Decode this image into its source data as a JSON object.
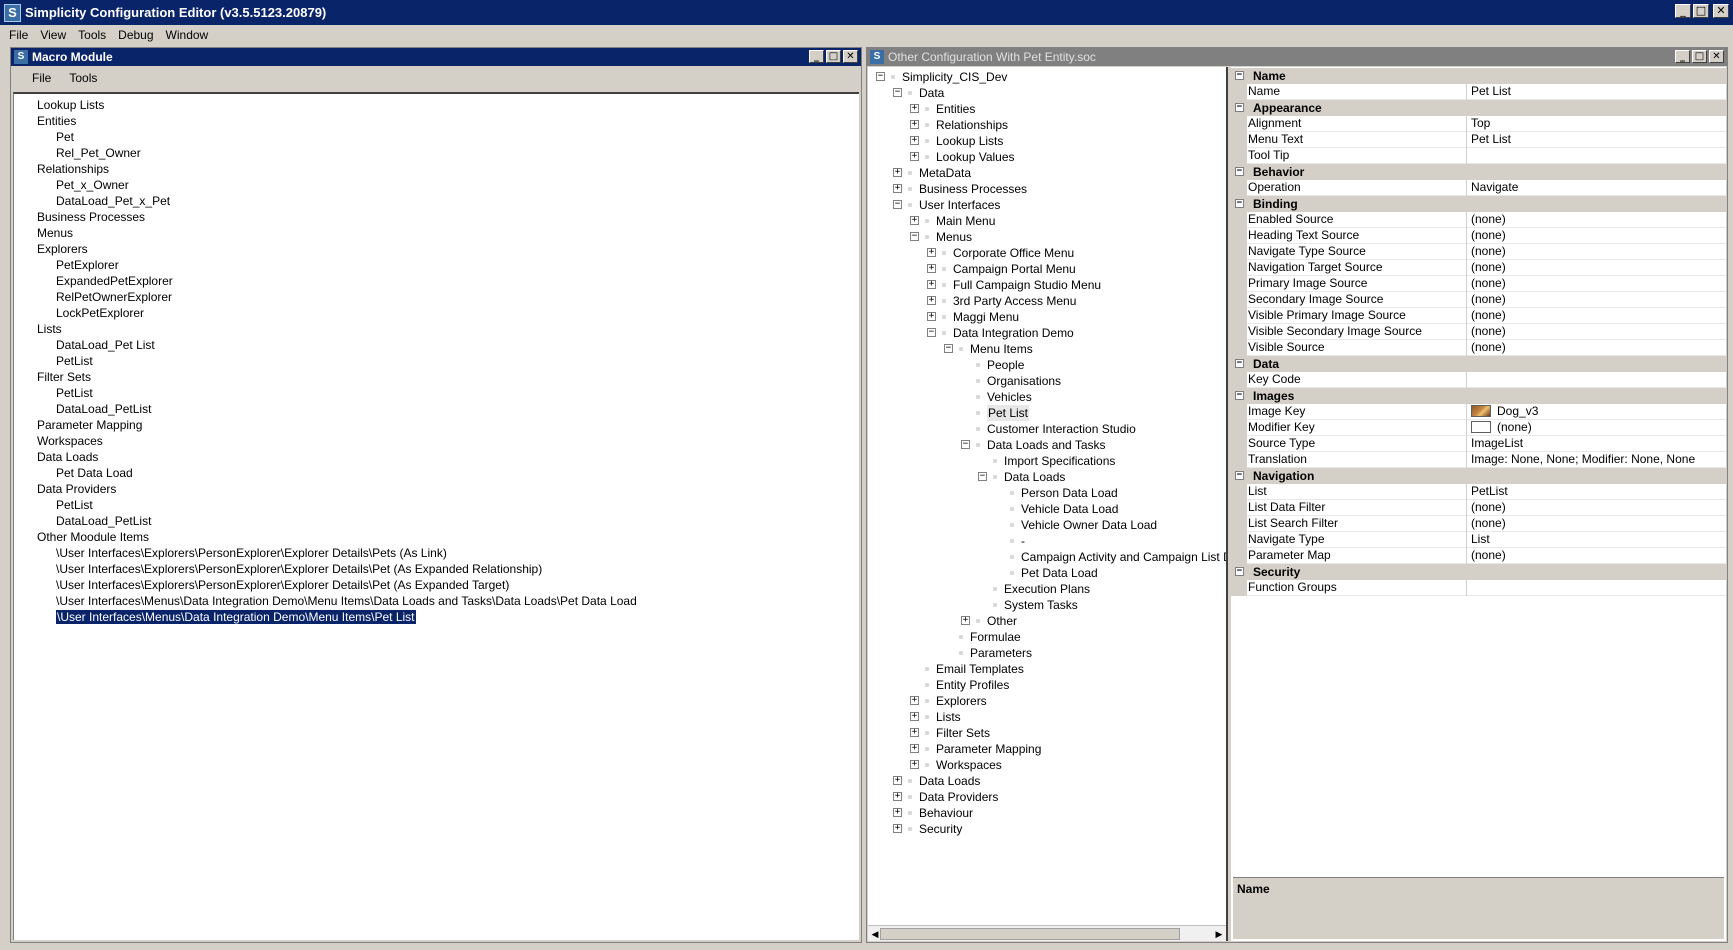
{
  "app": {
    "title": "Simplicity Configuration Editor (v3.5.5123.20879)",
    "logo_letter": "S",
    "menu": [
      "File",
      "View",
      "Tools",
      "Debug",
      "Window"
    ]
  },
  "macro_module": {
    "title": "Macro Module",
    "menu": [
      "File",
      "Tools"
    ],
    "items": [
      {
        "text": "Lookup Lists",
        "level": 0
      },
      {
        "text": "Entities",
        "level": 0
      },
      {
        "text": "Pet",
        "level": 1
      },
      {
        "text": "Rel_Pet_Owner",
        "level": 1
      },
      {
        "text": "Relationships",
        "level": 0
      },
      {
        "text": "Pet_x_Owner",
        "level": 1
      },
      {
        "text": "DataLoad_Pet_x_Pet",
        "level": 1
      },
      {
        "text": "Business Processes",
        "level": 0
      },
      {
        "text": "Menus",
        "level": 0
      },
      {
        "text": "Explorers",
        "level": 0
      },
      {
        "text": "PetExplorer",
        "level": 1
      },
      {
        "text": "ExpandedPetExplorer",
        "level": 1
      },
      {
        "text": "RelPetOwnerExplorer",
        "level": 1
      },
      {
        "text": "LockPetExplorer",
        "level": 1
      },
      {
        "text": "Lists",
        "level": 0
      },
      {
        "text": "DataLoad_Pet List",
        "level": 1
      },
      {
        "text": "PetList",
        "level": 1
      },
      {
        "text": "Filter Sets",
        "level": 0
      },
      {
        "text": "PetList",
        "level": 1
      },
      {
        "text": "DataLoad_PetList",
        "level": 1
      },
      {
        "text": "Parameter Mapping",
        "level": 0
      },
      {
        "text": "Workspaces",
        "level": 0
      },
      {
        "text": "Data Loads",
        "level": 0
      },
      {
        "text": "Pet Data Load",
        "level": 1
      },
      {
        "text": "Data Providers",
        "level": 0
      },
      {
        "text": "PetList",
        "level": 1
      },
      {
        "text": "DataLoad_PetList",
        "level": 1
      },
      {
        "text": "Other Moodule Items",
        "level": 0
      },
      {
        "text": "\\User Interfaces\\Explorers\\PersonExplorer\\Explorer Details\\Pets (As Link)",
        "level": 1
      },
      {
        "text": "\\User Interfaces\\Explorers\\PersonExplorer\\Explorer Details\\Pet (As Expanded Relationship)",
        "level": 1
      },
      {
        "text": "\\User Interfaces\\Explorers\\PersonExplorer\\Explorer Details\\Pet (As Expanded Target)",
        "level": 1
      },
      {
        "text": "\\User Interfaces\\Menus\\Data Integration Demo\\Menu Items\\Data Loads and Tasks\\Data Loads\\Pet Data Load",
        "level": 1
      },
      {
        "text": "\\User Interfaces\\Menus\\Data Integration Demo\\Menu Items\\Pet List",
        "level": 1,
        "selected": true
      }
    ]
  },
  "config": {
    "title": "Other Configuration With Pet Entity.soc",
    "tree": [
      {
        "text": "Simplicity_CIS_Dev",
        "level": 0,
        "exp": "-"
      },
      {
        "text": "Data",
        "level": 1,
        "exp": "-"
      },
      {
        "text": "Entities",
        "level": 2,
        "exp": "+"
      },
      {
        "text": "Relationships",
        "level": 2,
        "exp": "+"
      },
      {
        "text": "Lookup Lists",
        "level": 2,
        "exp": "+"
      },
      {
        "text": "Lookup Values",
        "level": 2,
        "exp": "+"
      },
      {
        "text": "MetaData",
        "level": 1,
        "exp": "+"
      },
      {
        "text": "Business Processes",
        "level": 1,
        "exp": "+"
      },
      {
        "text": "User Interfaces",
        "level": 1,
        "exp": "-"
      },
      {
        "text": "Main Menu",
        "level": 2,
        "exp": "+"
      },
      {
        "text": "Menus",
        "level": 2,
        "exp": "-"
      },
      {
        "text": "Corporate Office Menu",
        "level": 3,
        "exp": "+"
      },
      {
        "text": "Campaign Portal Menu",
        "level": 3,
        "exp": "+"
      },
      {
        "text": "Full Campaign Studio Menu",
        "level": 3,
        "exp": "+"
      },
      {
        "text": "3rd Party Access Menu",
        "level": 3,
        "exp": "+"
      },
      {
        "text": "Maggi Menu",
        "level": 3,
        "exp": "+"
      },
      {
        "text": "Data Integration Demo",
        "level": 3,
        "exp": "-"
      },
      {
        "text": "Menu Items",
        "level": 4,
        "exp": "-"
      },
      {
        "text": "People",
        "level": 5,
        "exp": ""
      },
      {
        "text": "Organisations",
        "level": 5,
        "exp": ""
      },
      {
        "text": "Vehicles",
        "level": 5,
        "exp": ""
      },
      {
        "text": "Pet List",
        "level": 5,
        "exp": "",
        "highlight": true
      },
      {
        "text": "Customer Interaction Studio",
        "level": 5,
        "exp": ""
      },
      {
        "text": "Data Loads and Tasks",
        "level": 5,
        "exp": "-"
      },
      {
        "text": "Import Specifications",
        "level": 6,
        "exp": ""
      },
      {
        "text": "Data Loads",
        "level": 6,
        "exp": "-"
      },
      {
        "text": "Person Data Load",
        "level": 7,
        "exp": ""
      },
      {
        "text": "Vehicle Data Load",
        "level": 7,
        "exp": ""
      },
      {
        "text": "Vehicle Owner Data Load",
        "level": 7,
        "exp": ""
      },
      {
        "text": "-",
        "level": 7,
        "exp": ""
      },
      {
        "text": "Campaign Activity and Campaign List D",
        "level": 7,
        "exp": ""
      },
      {
        "text": "Pet Data Load",
        "level": 7,
        "exp": ""
      },
      {
        "text": "Execution Plans",
        "level": 6,
        "exp": ""
      },
      {
        "text": "System Tasks",
        "level": 6,
        "exp": ""
      },
      {
        "text": "Other",
        "level": 5,
        "exp": "+"
      },
      {
        "text": "Formulae",
        "level": 4,
        "exp": ""
      },
      {
        "text": "Parameters",
        "level": 4,
        "exp": ""
      },
      {
        "text": "Email Templates",
        "level": 2,
        "exp": ""
      },
      {
        "text": "Entity Profiles",
        "level": 2,
        "exp": ""
      },
      {
        "text": "Explorers",
        "level": 2,
        "exp": "+"
      },
      {
        "text": "Lists",
        "level": 2,
        "exp": "+"
      },
      {
        "text": "Filter Sets",
        "level": 2,
        "exp": "+"
      },
      {
        "text": "Parameter Mapping",
        "level": 2,
        "exp": "+"
      },
      {
        "text": "Workspaces",
        "level": 2,
        "exp": "+"
      },
      {
        "text": "Data Loads",
        "level": 1,
        "exp": "+"
      },
      {
        "text": "Data Providers",
        "level": 1,
        "exp": "+"
      },
      {
        "text": "Behaviour",
        "level": 1,
        "exp": "+"
      },
      {
        "text": "Security",
        "level": 1,
        "exp": "+"
      }
    ],
    "properties": [
      {
        "category": "Name",
        "rows": [
          {
            "key": "Name",
            "value": "Pet List"
          }
        ]
      },
      {
        "category": "Appearance",
        "rows": [
          {
            "key": "Alignment",
            "value": "Top"
          },
          {
            "key": "Menu Text",
            "value": "Pet List"
          },
          {
            "key": "Tool Tip",
            "value": ""
          }
        ]
      },
      {
        "category": "Behavior",
        "rows": [
          {
            "key": "Operation",
            "value": "Navigate"
          }
        ]
      },
      {
        "category": "Binding",
        "rows": [
          {
            "key": "Enabled Source",
            "value": "(none)"
          },
          {
            "key": "Heading Text Source",
            "value": "(none)"
          },
          {
            "key": "Navigate Type Source",
            "value": "(none)"
          },
          {
            "key": "Navigation Target Source",
            "value": "(none)"
          },
          {
            "key": "Primary Image Source",
            "value": "(none)"
          },
          {
            "key": "Secondary Image Source",
            "value": "(none)"
          },
          {
            "key": "Visible Primary Image Source",
            "value": "(none)"
          },
          {
            "key": "Visible Secondary Image Source",
            "value": "(none)"
          },
          {
            "key": "Visible Source",
            "value": "(none)"
          }
        ]
      },
      {
        "category": "Data",
        "rows": [
          {
            "key": "Key Code",
            "value": ""
          }
        ]
      },
      {
        "category": "Images",
        "rows": [
          {
            "key": "Image Key",
            "value": "Dog_v3",
            "swatch": "dog"
          },
          {
            "key": "Modifier Key",
            "value": "(none)",
            "swatch": "blank"
          },
          {
            "key": "Source Type",
            "value": "ImageList"
          },
          {
            "key": "Translation",
            "value": "Image: None, None; Modifier: None, None",
            "expand": "+"
          }
        ]
      },
      {
        "category": "Navigation",
        "rows": [
          {
            "key": "List",
            "value": "PetList"
          },
          {
            "key": "List Data Filter",
            "value": "(none)"
          },
          {
            "key": "List Search Filter",
            "value": "(none)"
          },
          {
            "key": "Navigate Type",
            "value": "List"
          },
          {
            "key": "Parameter Map",
            "value": "(none)"
          }
        ]
      },
      {
        "category": "Security",
        "rows": [
          {
            "key": "Function Groups",
            "value": "",
            "expand": "+"
          }
        ]
      }
    ],
    "description_title": "Name"
  }
}
